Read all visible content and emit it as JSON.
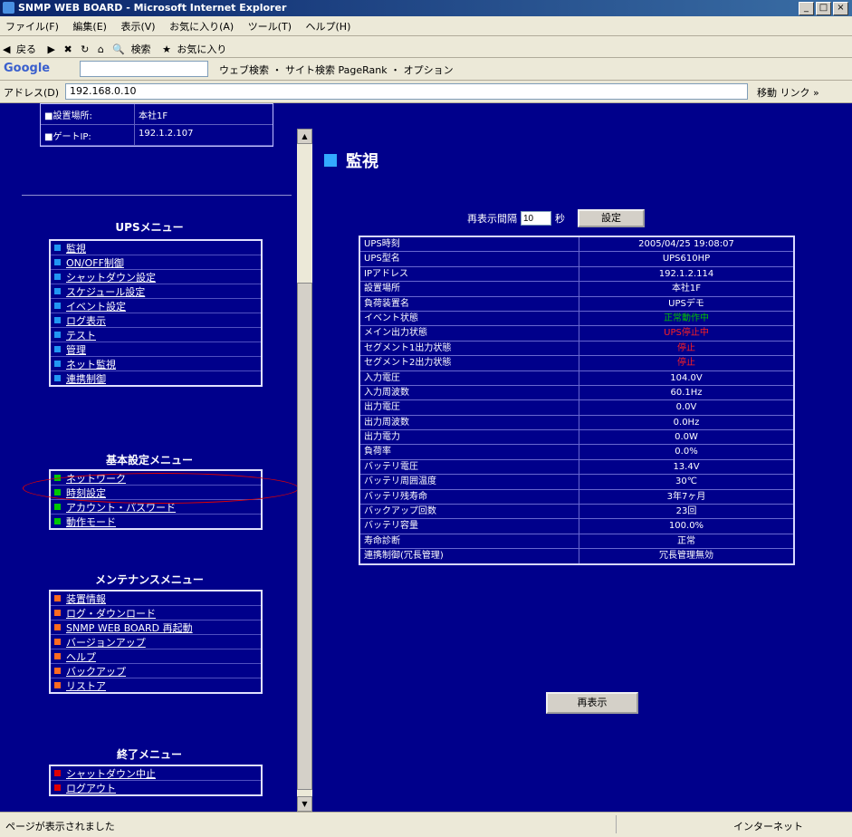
{
  "window": {
    "title": "SNMP WEB BOARD - Microsoft Internet Explorer",
    "buttons": [
      "_",
      "□",
      "×"
    ]
  },
  "menubar": [
    "ファイル(F)",
    "編集(E)",
    "表示(V)",
    "お気に入り(A)",
    "ツール(T)",
    "ヘルプ(H)"
  ],
  "toolbar": {
    "back": "戻る",
    "search": "検索",
    "favorites": "お気に入り"
  },
  "googlebar": {
    "logo": "Google",
    "items": "ウェブ検索 ・ サイト検索 PageRank ・ オプション"
  },
  "addressbar": {
    "label": "アドレス(D)",
    "url": "192.168.0.10",
    "go": "移動",
    "links": "リンク »"
  },
  "left": {
    "info_rows": [
      {
        "k": "■設置場所:",
        "v": "本社1F"
      },
      {
        "k": "■ゲートIP:",
        "v": "192.1.2.107"
      }
    ],
    "ups_menu": {
      "title": "UPSメニュー",
      "items": [
        "監視",
        "ON/OFF制御",
        "シャットダウン設定",
        "スケジュール設定",
        "イベント設定",
        "ログ表示",
        "テスト",
        "管理",
        "ネット監視",
        "連携制御"
      ]
    },
    "basic_menu": {
      "title": "基本設定メニュー",
      "items": [
        "ネットワーク",
        "時刻設定",
        "アカウント・パスワード",
        "動作モード"
      ]
    },
    "maint_menu": {
      "title": "メンテナンスメニュー",
      "items": [
        "装置情報",
        "ログ・ダウンロード",
        "SNMP WEB BOARD 再起動",
        "バージョンアップ",
        "ヘルプ",
        "バックアップ",
        "リストア"
      ]
    },
    "exit_menu": {
      "title": "終了メニュー",
      "items": [
        "シャットダウン中止",
        "ログアウト"
      ]
    }
  },
  "main": {
    "title": "監視",
    "refresh": {
      "label": "再表示間隔",
      "value": "10",
      "unit": "秒",
      "button": "設定"
    },
    "rows": [
      {
        "k": "UPS時刻",
        "v": "2005/04/25 19:08:07"
      },
      {
        "k": "UPS型名",
        "v": "UPS610HP"
      },
      {
        "k": "IPアドレス",
        "v": "192.1.2.114"
      },
      {
        "k": "設置場所",
        "v": "本社1F"
      },
      {
        "k": "負荷装置名",
        "v": "UPSデモ"
      },
      {
        "k": "イベント状態",
        "v": "正常動作中",
        "color": "#00c000"
      },
      {
        "k": "メイン出力状態",
        "v": "UPS停止中",
        "color": "#ff2020"
      },
      {
        "k": "セグメント1出力状態",
        "v": "停止",
        "color": "#ff2020"
      },
      {
        "k": "セグメント2出力状態",
        "v": "停止",
        "color": "#ff2020"
      },
      {
        "k": "入力電圧",
        "v": "104.0V"
      },
      {
        "k": "入力周波数",
        "v": "60.1Hz"
      },
      {
        "k": "出力電圧",
        "v": "0.0V"
      },
      {
        "k": "出力周波数",
        "v": "0.0Hz"
      },
      {
        "k": "出力電力",
        "v": "0.0W"
      },
      {
        "k": "負荷率",
        "v": "0.0%"
      },
      {
        "k": "バッテリ電圧",
        "v": "13.4V"
      },
      {
        "k": "バッテリ周囲温度",
        "v": "30℃"
      },
      {
        "k": "バッテリ残寿命",
        "v": "3年7ヶ月"
      },
      {
        "k": "バックアップ回数",
        "v": "23回"
      },
      {
        "k": "バッテリ容量",
        "v": "100.0%"
      },
      {
        "k": "寿命診断",
        "v": "正常"
      },
      {
        "k": "連携制御(冗長管理)",
        "v": "冗長管理無効"
      }
    ],
    "reload_button": "再表示"
  },
  "statusbar": {
    "message": "ページが表示されました",
    "zone": "インターネット"
  },
  "colors": {
    "menu_blue": "#2196f3",
    "menu_green": "#00c800",
    "menu_orange": "#ff6a20",
    "menu_red": "#e00000"
  }
}
